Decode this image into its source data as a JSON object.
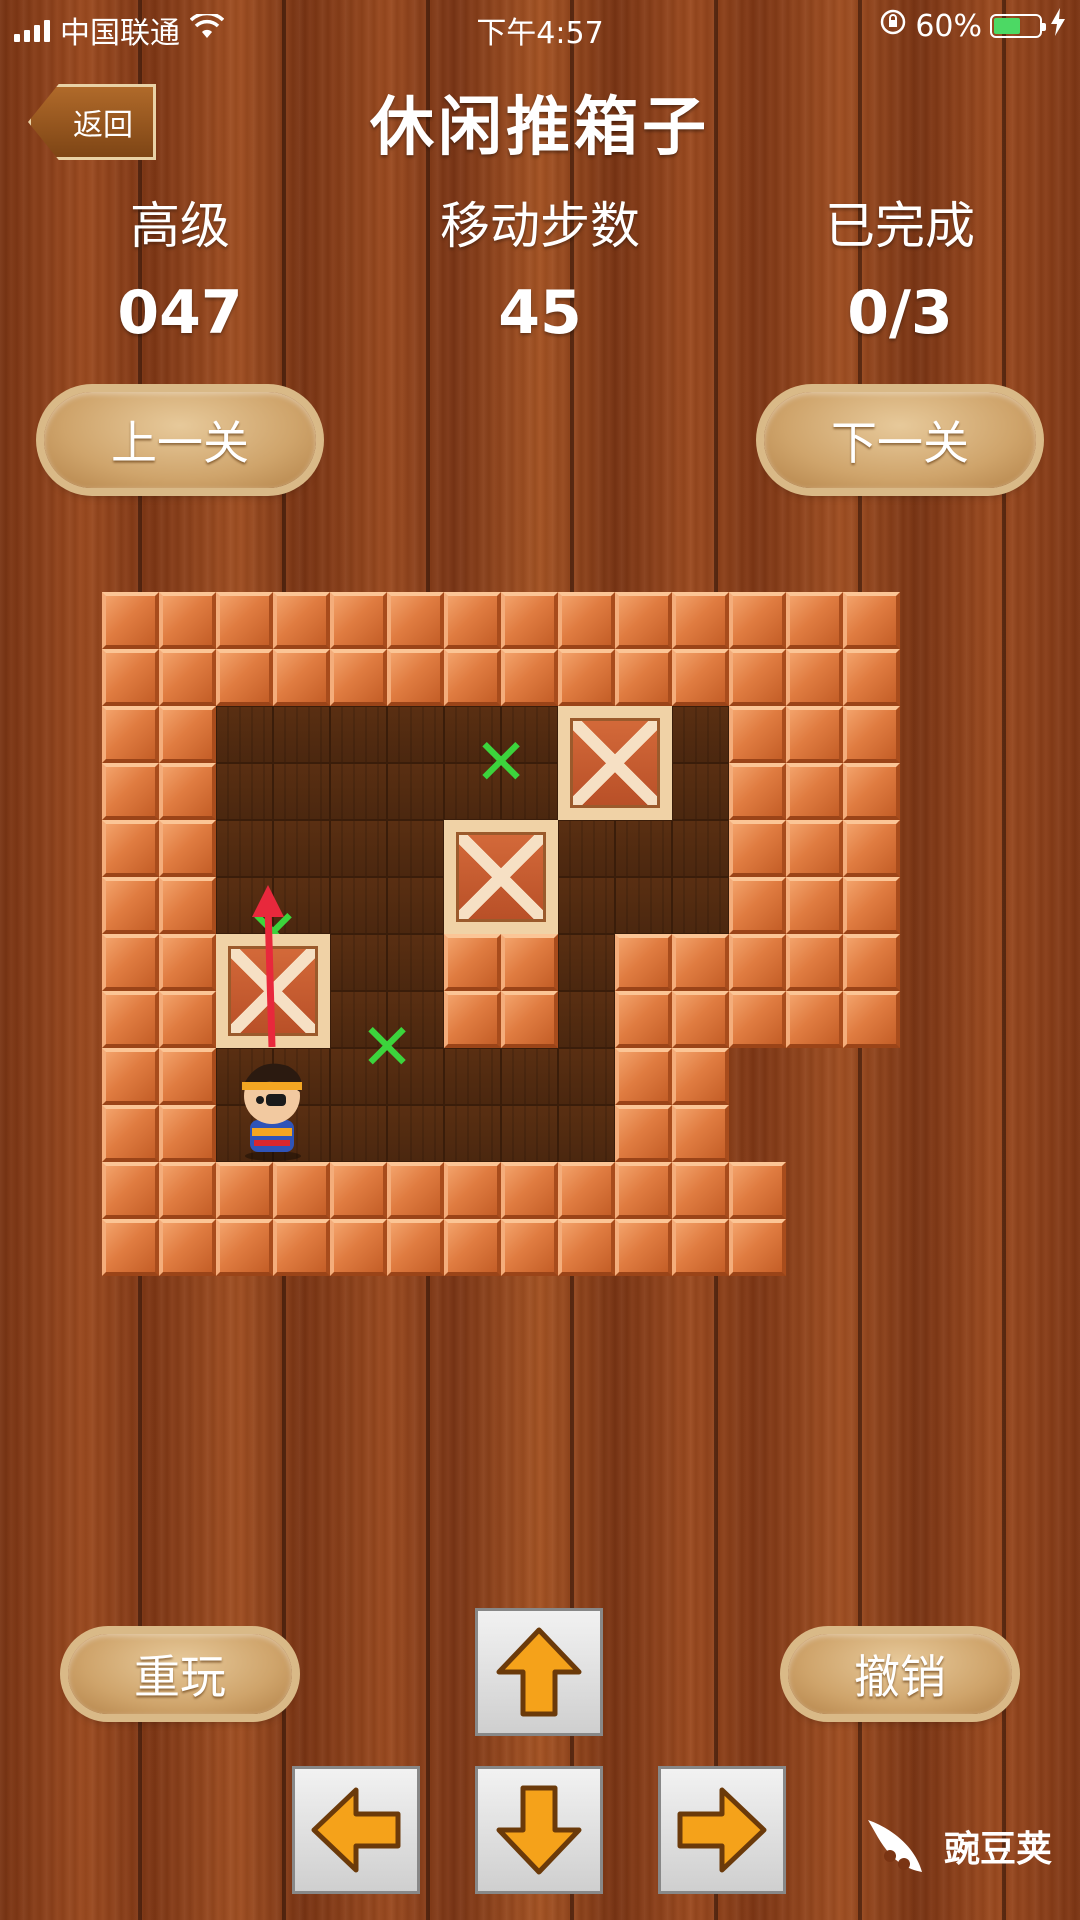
{
  "status_bar": {
    "carrier": "中国联通",
    "time": "下午4:57",
    "battery": "60%",
    "battery_level": 0.6
  },
  "header": {
    "back_label": "返回",
    "title": "休闲推箱子"
  },
  "stats": [
    {
      "label": "高级",
      "value": "047"
    },
    {
      "label": "移动步数",
      "value": "45"
    },
    {
      "label": "已完成",
      "value": "0/3"
    }
  ],
  "nav": {
    "prev_label": "上一关",
    "next_label": "下一关"
  },
  "controls": {
    "restart_label": "重玩",
    "undo_label": "撤销"
  },
  "dpad": {
    "up": "up-arrow-icon",
    "down": "down-arrow-icon",
    "left": "left-arrow-icon",
    "right": "right-arrow-icon"
  },
  "board": {
    "legend": {
      "W": "wall",
      ".": "floor",
      "T": "target",
      " ": "empty"
    },
    "rows": [
      "WWWWWWWWWWWWWW",
      "WWWWWWWWWWWWWW",
      "WW.........WWW",
      "WW.........WWW",
      "WW.........WWW",
      "WW.........WWW",
      "WW....WW.WWWWW",
      "WW....WW.WWWWW",
      "WW.......WW   ",
      "WW.......WW   ",
      "WWWWWWWWWWWW  ",
      "WWWWWWWWWWWW  "
    ],
    "targets": [
      [
        2,
        6
      ],
      [
        5,
        2
      ],
      [
        7,
        4
      ]
    ],
    "boxes": [
      [
        2,
        8
      ],
      [
        4,
        6
      ],
      [
        6,
        2
      ]
    ],
    "player": [
      8,
      2
    ]
  },
  "branding": {
    "logo_text": "豌豆荚"
  }
}
